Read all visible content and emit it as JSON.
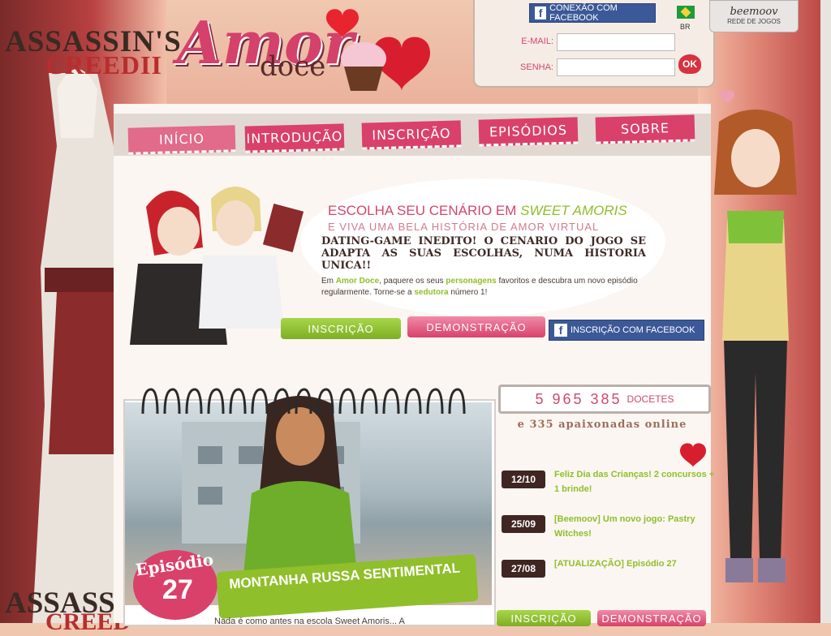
{
  "ads": {
    "left_title": "ASSASSIN'S",
    "left_subtitle": "CREEDII",
    "left_title_bottom": "ASSASSIN'S",
    "left_subtitle_bottom": "CREED"
  },
  "header": {
    "logo_main": "Amor",
    "logo_sub": "doce"
  },
  "login": {
    "facebook_label": "CONEXÃO COM FACEBOOK",
    "email_label": "E-MAIL:",
    "password_label": "SENHA:",
    "ok_label": "OK",
    "lang": "BR",
    "beemoov_brand": "beemoov",
    "beemoov_sub": "REDE DE JOGOS"
  },
  "nav": {
    "items": [
      {
        "label": "INÍCIO"
      },
      {
        "label": "INTRODUÇÃO"
      },
      {
        "label": "INSCRIÇÃO"
      },
      {
        "label": "EPISÓDIOS"
      },
      {
        "label": "SOBRE"
      }
    ]
  },
  "hero": {
    "title_prefix": "ESCOLHA SEU CENÁRIO EM",
    "title_brand": "SWEET AMORIS",
    "subtitle": "E VIVA UMA BELA HISTÓRIA DE AMOR VIRTUAL",
    "bold": "DATING-GAME INEDITO! O CENARIO DO JOGO SE ADAPTA AS SUAS ESCOLHAS, NUMA HISTORIA UNICA!!",
    "text_1": "Em",
    "text_brand": "Amor Doce",
    "text_2": ", paquere os seus",
    "text_chars": "personagens",
    "text_3": "favoritos e descubra um novo episódio regularmente. Torne-se a",
    "text_seductress": "sedutora",
    "text_4": "número 1!",
    "btn_signup": "INSCRIÇÃO",
    "btn_demo": "DEMONSTRAÇÃO",
    "btn_fb_signup": "INSCRIÇÃO COM FACEBOOK"
  },
  "episode": {
    "badge_label": "Episódio",
    "badge_number": "27",
    "title": "MONTANHA RUSSA SENTIMENTAL",
    "text": "Nada é como antes na escola Sweet Amoris... A"
  },
  "stats": {
    "count": "5 965 385",
    "count_suffix": "DOCETES",
    "online": "e 335 apaixonadas online"
  },
  "news": [
    {
      "date": "12/10",
      "text": "Feliz Dia das Crianças! 2 concursos + 1 brinde!"
    },
    {
      "date": "25/09",
      "text": "[Beemoov] Um novo jogo: Pastry Witches!"
    },
    {
      "date": "27/08",
      "text": "[ATUALIZAÇÃO] Episódio 27"
    }
  ],
  "bottom_buttons": {
    "signup": "INSCRIÇÃO",
    "demo": "DEMONSTRAÇÃO"
  },
  "colors": {
    "pink": "#d9416a",
    "green": "#8fbf2a",
    "facebook": "#3b5998",
    "dark_brown": "#3f2622"
  }
}
